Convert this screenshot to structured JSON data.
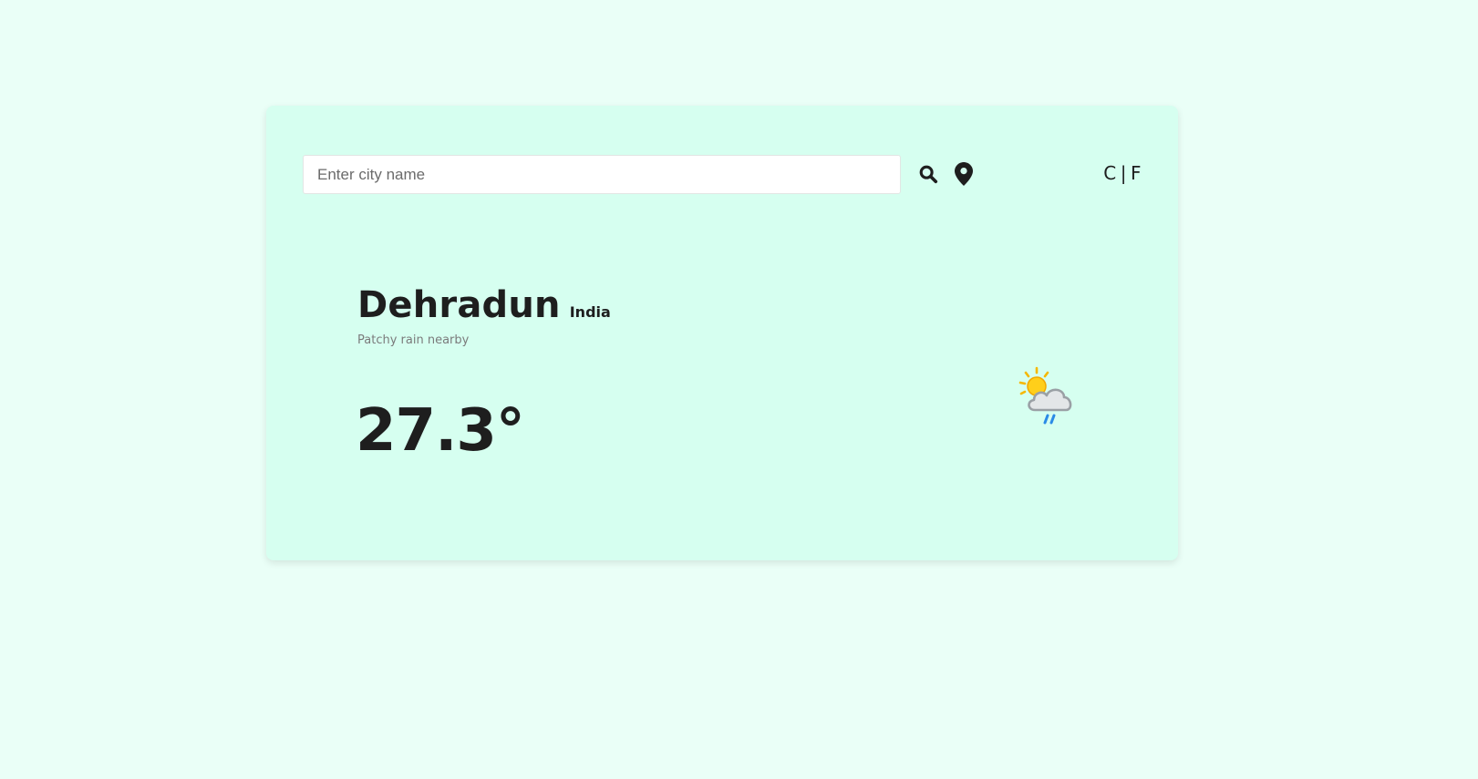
{
  "search": {
    "placeholder": "Enter city name",
    "value": ""
  },
  "icons": {
    "search": "search-icon",
    "location": "map-pin-icon",
    "weather": "partly-sunny-rain-icon"
  },
  "units": {
    "celsius": "C",
    "separator": "|",
    "fahrenheit": "F"
  },
  "weather": {
    "city": "Dehradun",
    "country": "India",
    "condition": "Patchy rain nearby",
    "temperature": "27.3°"
  },
  "colors": {
    "page_background": "#eafff7",
    "card_background": "#d6fff0",
    "text": "#1e1e1e",
    "muted_text": "#7b7b7b",
    "sun": "#f5b800",
    "cloud": "#b9bec2",
    "rain": "#2b8be6"
  }
}
